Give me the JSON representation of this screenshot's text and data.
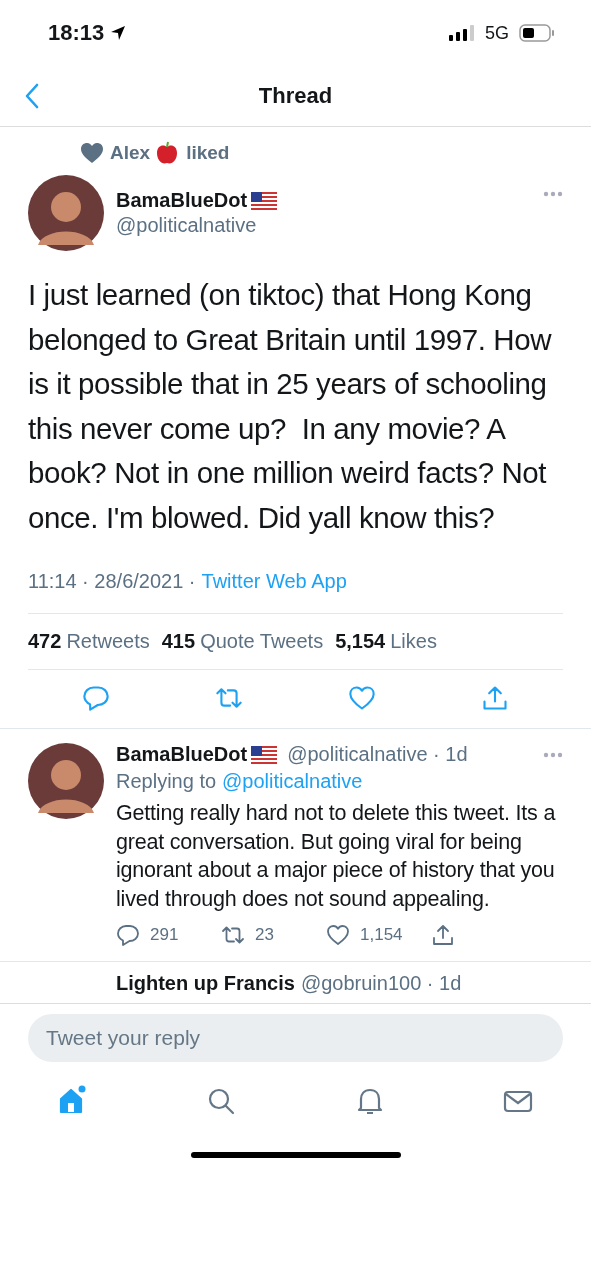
{
  "status_bar": {
    "time": "18:13",
    "network": "5G"
  },
  "nav": {
    "title": "Thread"
  },
  "social_context": {
    "name": "Alex",
    "action": "liked"
  },
  "tweet": {
    "name": "BamaBlueDot",
    "handle": "@politicalnative",
    "text": "I just learned (on tiktoc) that Hong Kong belonged to Great Britain until 1997. How is it possible that in 25 years of schooling  this never come up?  In any movie? A book? Not in one million weird facts? Not once. I'm blowed. Did yall know this?",
    "timestamp": "11:14 · 28/6/2021 ·",
    "source": "Twitter Web App",
    "stats": [
      {
        "count": "472",
        "label": "Retweets"
      },
      {
        "count": "415",
        "label": "Quote Tweets"
      },
      {
        "count": "5,154",
        "label": "Likes"
      }
    ],
    "actions": [
      {
        "kind": "reply"
      },
      {
        "kind": "retweet"
      },
      {
        "kind": "like"
      },
      {
        "kind": "share"
      }
    ]
  },
  "reply": {
    "name": "BamaBlueDot",
    "handle": "@politicalnative · 1d",
    "replying_label": "Replying to",
    "replying_handle": "@politicalnative",
    "text": "Getting really hard not to delete this tweet. Its a great conversation. But going viral for being ignorant about a major piece of history that you lived through does not sound appealing.",
    "actions": [
      {
        "kind": "reply",
        "count": "291"
      },
      {
        "kind": "retweet",
        "count": "23"
      },
      {
        "kind": "like",
        "count": "1,154"
      },
      {
        "kind": "share"
      }
    ]
  },
  "next_reply": {
    "name": "Lighten up Francis",
    "handle": "@gobruin100 · 1d"
  },
  "composer": {
    "placeholder": "Tweet your reply"
  },
  "tab_bar": [
    {
      "kind": "home",
      "selected": true
    },
    {
      "kind": "search",
      "selected": false
    },
    {
      "kind": "notifications",
      "selected": false
    },
    {
      "kind": "messages",
      "selected": false
    }
  ]
}
